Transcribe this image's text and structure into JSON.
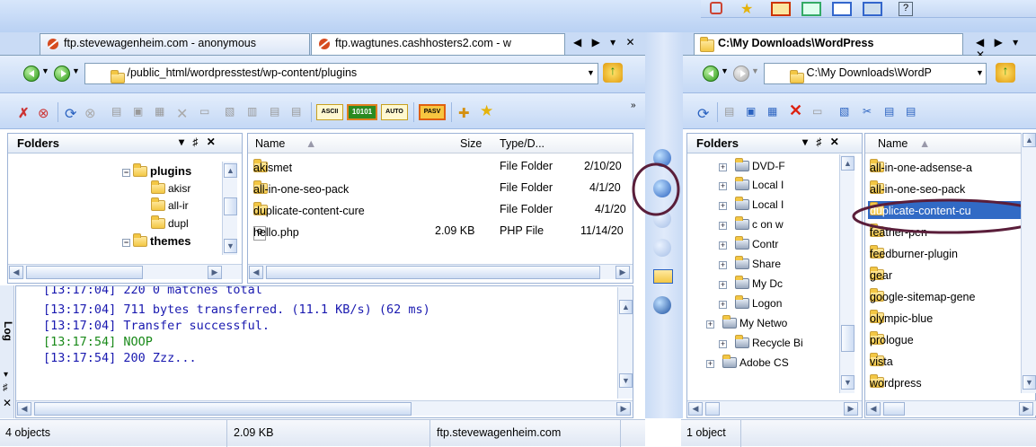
{
  "left_tabs": [
    {
      "label": "ftp.stevewagenheim.com - anonymous"
    },
    {
      "label": "ftp.wagtunes.cashhosters2.com - w"
    }
  ],
  "right_tab": {
    "label": "C:\\My Downloads\\WordPress"
  },
  "tab_nav": "◀ ▶ ▾ ✕",
  "left_address": "/public_html/wordpresstest/wp-content/plugins",
  "right_address": "C:\\My Downloads\\WordP",
  "transfer_buttons": {
    "ascii": "ASCII",
    "binary": "10101",
    "auto": "AUTO",
    "pasv": "PASV"
  },
  "left_folders_pane": {
    "title": "Folders",
    "controls": "▾ ♯ ✕",
    "items": [
      {
        "label": "plugins",
        "bold": true
      },
      {
        "label": "akisr"
      },
      {
        "label": "all-ir"
      },
      {
        "label": "dupl"
      },
      {
        "label": "themes",
        "bold": true
      }
    ]
  },
  "file_list": {
    "columns": {
      "name": "Name",
      "size": "Size",
      "type": "Type/D..."
    },
    "rows": [
      {
        "name": "akismet",
        "size": "",
        "type": "File Folder",
        "date": "2/10/20"
      },
      {
        "name": "all-in-one-seo-pack",
        "size": "",
        "type": "File Folder",
        "date": "4/1/20"
      },
      {
        "name": "duplicate-content-cure",
        "size": "",
        "type": "File Folder",
        "date": "4/1/20"
      },
      {
        "name": "hello.php",
        "size": "2.09 KB",
        "type": "PHP File",
        "date": "11/14/20"
      }
    ]
  },
  "log": {
    "side_label": "Log",
    "lines": [
      {
        "text": "[13:17:04] 220 0 matches total",
        "color": "#1a1ab0"
      },
      {
        "text": "[13:17:04] 711 bytes transferred. (11.1 KB/s) (62 ms)",
        "color": "#1a1ab0"
      },
      {
        "text": "[13:17:04] Transfer successful.",
        "color": "#1a1ab0"
      },
      {
        "text": "[13:17:54] NOOP",
        "color": "#1a8a1a"
      },
      {
        "text": "[13:17:54] 200 Zzz...",
        "color": "#1a1ab0"
      }
    ]
  },
  "right_folders_pane": {
    "title": "Folders",
    "controls": "▾ ♯ ✕",
    "items": [
      {
        "label": "DVD-F"
      },
      {
        "label": "Local I"
      },
      {
        "label": "Local I"
      },
      {
        "label": "c on w"
      },
      {
        "label": "Contr"
      },
      {
        "label": "Share"
      },
      {
        "label": "My Dc"
      },
      {
        "label": "Logon"
      },
      {
        "label": "My Netwo"
      },
      {
        "label": "Recycle Bi"
      },
      {
        "label": "Adobe CS"
      }
    ]
  },
  "right_file_list": {
    "column": "Name",
    "items": [
      {
        "name": "all-in-one-adsense-a"
      },
      {
        "name": "all-in-one-seo-pack"
      },
      {
        "name": "duplicate-content-cu",
        "selected": true
      },
      {
        "name": "feather-pen"
      },
      {
        "name": "feedburner-plugin"
      },
      {
        "name": "gear"
      },
      {
        "name": "google-sitemap-gene"
      },
      {
        "name": "olympic-blue"
      },
      {
        "name": "prologue"
      },
      {
        "name": "vista"
      },
      {
        "name": "wordpress"
      }
    ]
  },
  "status_left": {
    "objects": "4 objects",
    "size": "2.09 KB",
    "host": "ftp.stevewagenheim.com"
  },
  "status_right": {
    "objects": "1 object"
  },
  "colors": {
    "accent": "#316ac5",
    "annotation": "#5a1e3a",
    "log_text": "#1a1ab0",
    "noop": "#1a8a1a"
  }
}
